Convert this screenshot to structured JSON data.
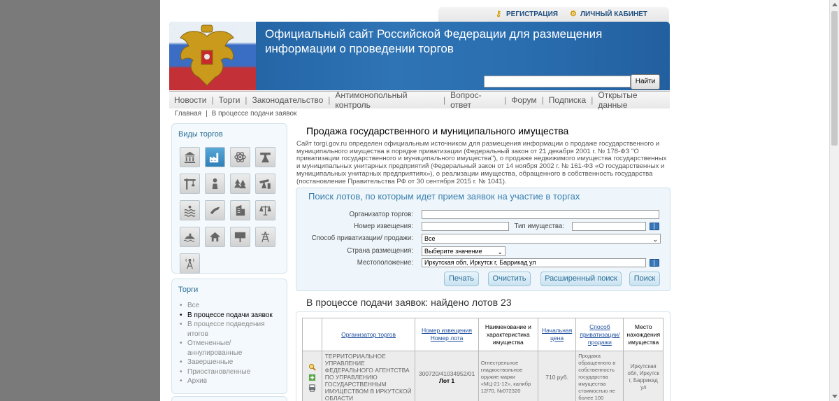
{
  "top_links": {
    "register": "РЕГИСТРАЦИЯ",
    "cabinet": "ЛИЧНЫЙ КАБИНЕТ"
  },
  "banner": {
    "title_line1": "Официальный сайт Российской Федерации для размещения",
    "title_line2": "информации о проведении торгов",
    "search_button": "Найти"
  },
  "nav": [
    "Новости",
    "Торги",
    "Законодательство",
    "Антимонопольный контроль",
    "Вопрос-ответ",
    "Форум",
    "Подписка",
    "Открытые данные"
  ],
  "breadcrumb": {
    "home": "Главная",
    "sep": "|",
    "current": "В процессе подачи заявок"
  },
  "sidebar": {
    "types_title": "Виды торгов",
    "type_icons": [
      "bank-icon",
      "factory-icon",
      "atom-icon",
      "drilling-rig-icon",
      "crane-icon",
      "person-icon",
      "forest-icon",
      "oil-pump-icon",
      "water-icon",
      "fishing-icon",
      "building-icon",
      "scales-icon",
      "jet-ski-icon",
      "house-icon",
      "billboard-icon",
      "power-line-icon",
      "radio-tower-icon"
    ],
    "active_icon_index": 1,
    "torgi_title": "Торги",
    "torgi_items": [
      "Все",
      "В процессе подачи заявок",
      "В процессе подведения итогов",
      "Отмененные/ аннулированные",
      "Завершенные",
      "Приостановленные",
      "Архив"
    ],
    "torgi_current": 1
  },
  "main": {
    "title": "Продажа государственного и муниципального имущества",
    "intro": "Сайт torgi.gov.ru определен официальным источником для размещения информации о продаже государственного и муниципального имущества в порядке приватизации (Федеральный закон от 21 декабря 2001 г. № 178-ФЗ \"О приватизации государственного и муниципального имущества\"), о продаже недвижимого имущества государственных и муниципальных унитарных предприятий (Федеральный закон от 14 ноября 2002 г. № 161-ФЗ «О государственных и муниципальных унитарных предприятиях»), о реализации имущества, обращенного в собственность государства (постановление Правительства РФ от 30 сентября 2015 г. № 1041)."
  },
  "search_form": {
    "title": "Поиск лотов, по которым идет прием заявок на участие в торгах",
    "labels": {
      "organizer": "Организатор торгов:",
      "notice_number": "Номер извещения:",
      "property_type": "Тип имущества:",
      "privatization_method": "Способ приватизации/ продажи:",
      "country": "Страна размещения:",
      "location": "Местоположение:"
    },
    "values": {
      "organizer": "",
      "notice_number": "",
      "property_type": "",
      "privatization_method": "Все",
      "country": "Выберите значение",
      "location": "Иркутская обл, Иркутск г, Баррикад ул"
    },
    "buttons": {
      "print": "Печать",
      "clear": "Очистить",
      "advanced": "Расширенный поиск",
      "search": "Поиск"
    }
  },
  "results": {
    "heading": "В процессе подачи заявок: найдено лотов 23",
    "columns": {
      "organizer": "Организатор торгов",
      "notice_line1": "Номер извещения",
      "notice_line2": "Номер лота",
      "name": "Наименование и характеристика имущества",
      "price": "Начальная цена",
      "method": "Способ приватизации/ продажи",
      "location": "Место нахождения имущества"
    },
    "rows": [
      {
        "organizer": "ТЕРРИТОРИАЛЬНОЕ УПРАВЛЕНИЕ ФЕДЕРАЛЬНОГО АГЕНТСТВА ПО УПРАВЛЕНИЮ ГОСУДАРСТВЕННЫМ ИМУЩЕСТВОМ В ИРКУТСКОЙ ОБЛАСТИ",
        "notice": "300720/41034952/01",
        "lot": "Лот 1",
        "name": "Огнестрельное гладкоствольное оружие марки «МЦ-21-12», калибр 12/70, №072320",
        "price": "710 руб.",
        "method": "Продажа обращенного в собственность государства имущества стоимостью не более 100",
        "location": "Иркутская обл, Иркутск г, Баррикад ул"
      }
    ]
  },
  "colors": {
    "accent": "#2b6e97",
    "banner": "#2f74b5",
    "link": "#1f4e9e"
  }
}
